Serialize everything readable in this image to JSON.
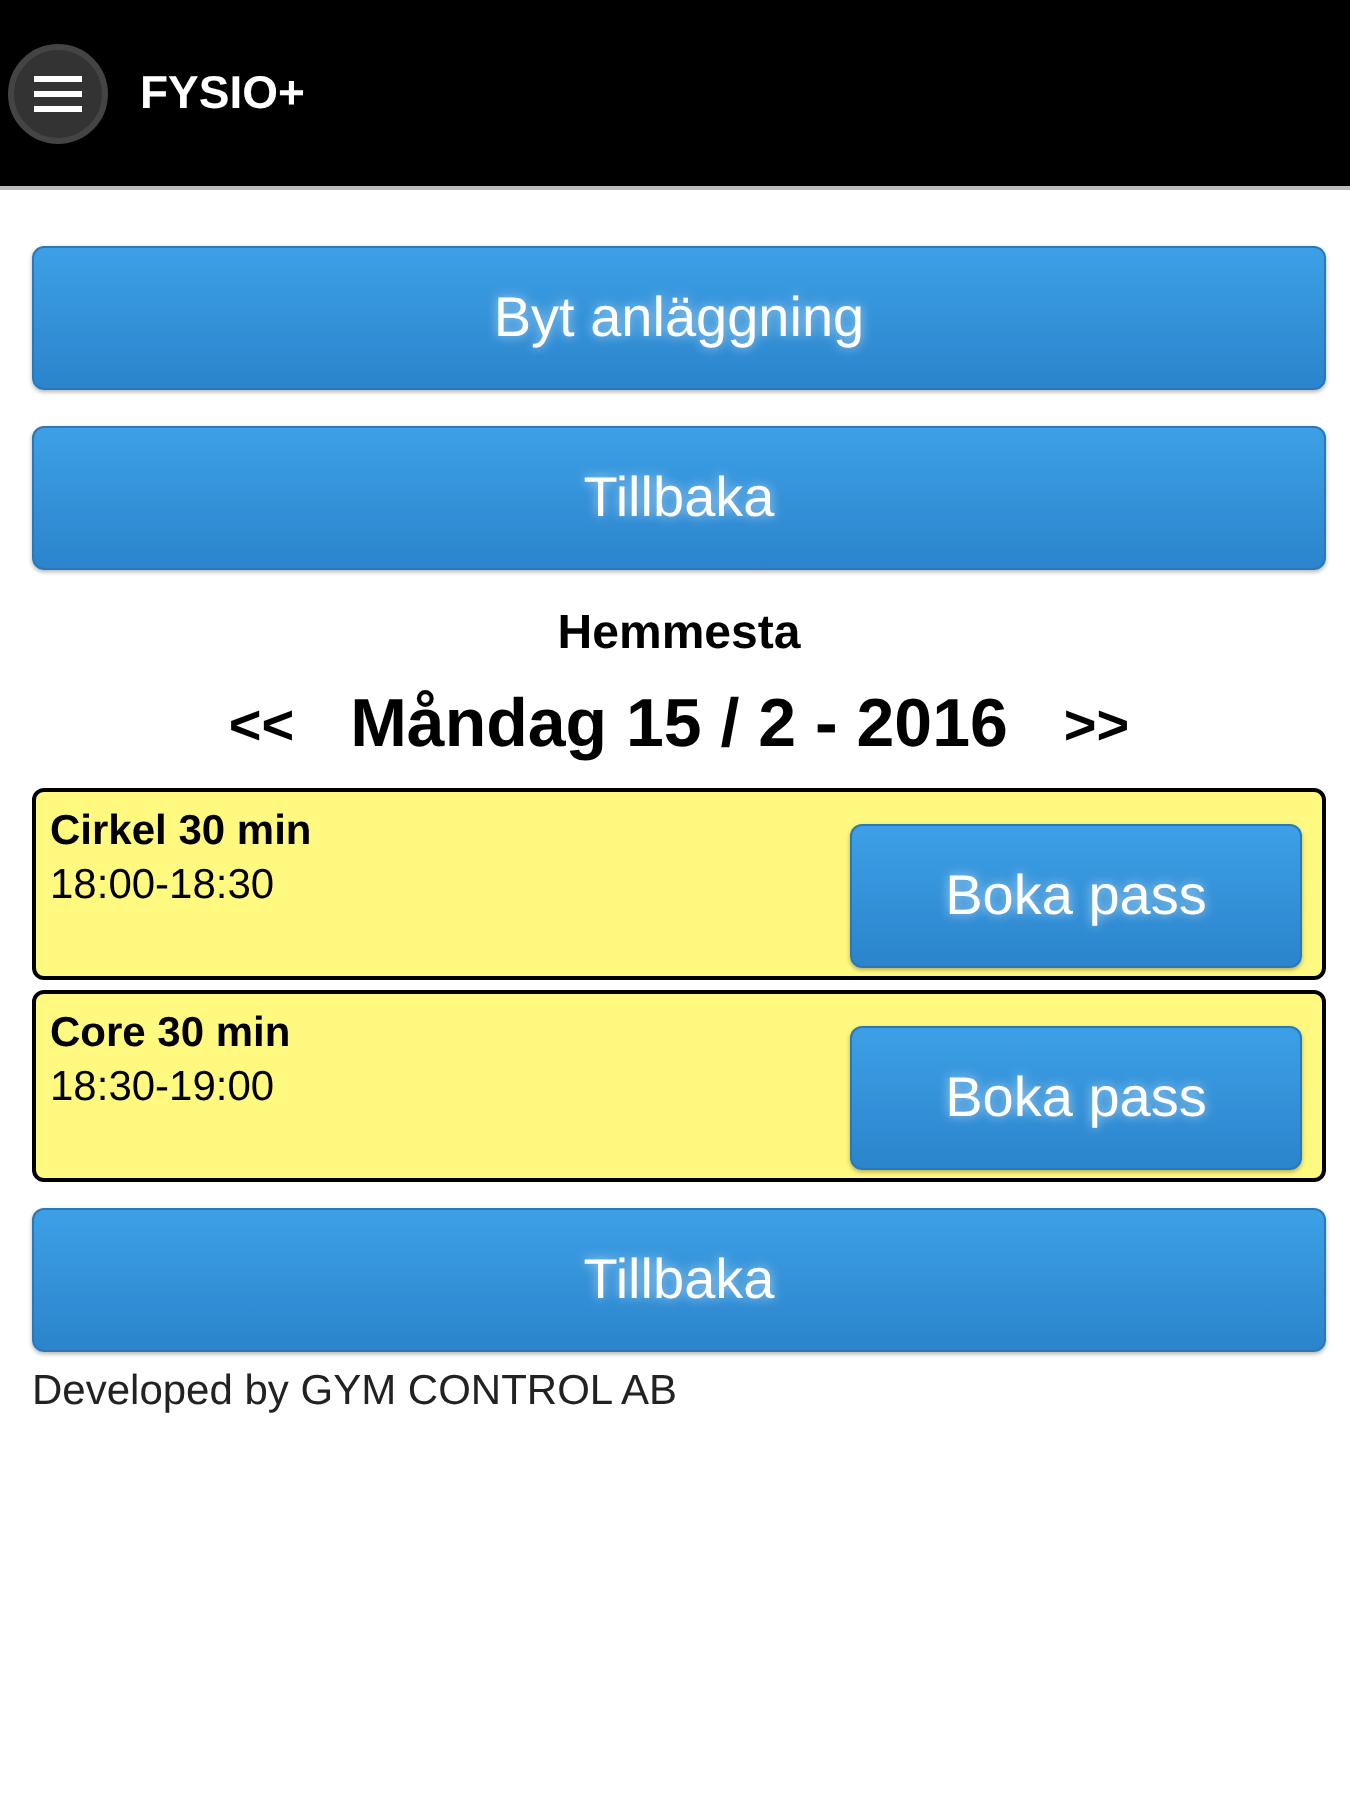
{
  "header": {
    "title": "FYSIO+"
  },
  "top_buttons": [
    "Byt anläggning",
    "Tillbaka"
  ],
  "facility": "Hemmesta",
  "date_nav": {
    "prev": "<<",
    "date": "Måndag 15 / 2 - 2016",
    "next": ">>"
  },
  "sessions": [
    {
      "name": "Cirkel 30 min",
      "time": "18:00-18:30",
      "button": "Boka pass"
    },
    {
      "name": "Core 30 min",
      "time": "18:30-19:00",
      "button": "Boka pass"
    }
  ],
  "bottom_button": "Tillbaka",
  "footer": "Developed by GYM CONTROL AB"
}
